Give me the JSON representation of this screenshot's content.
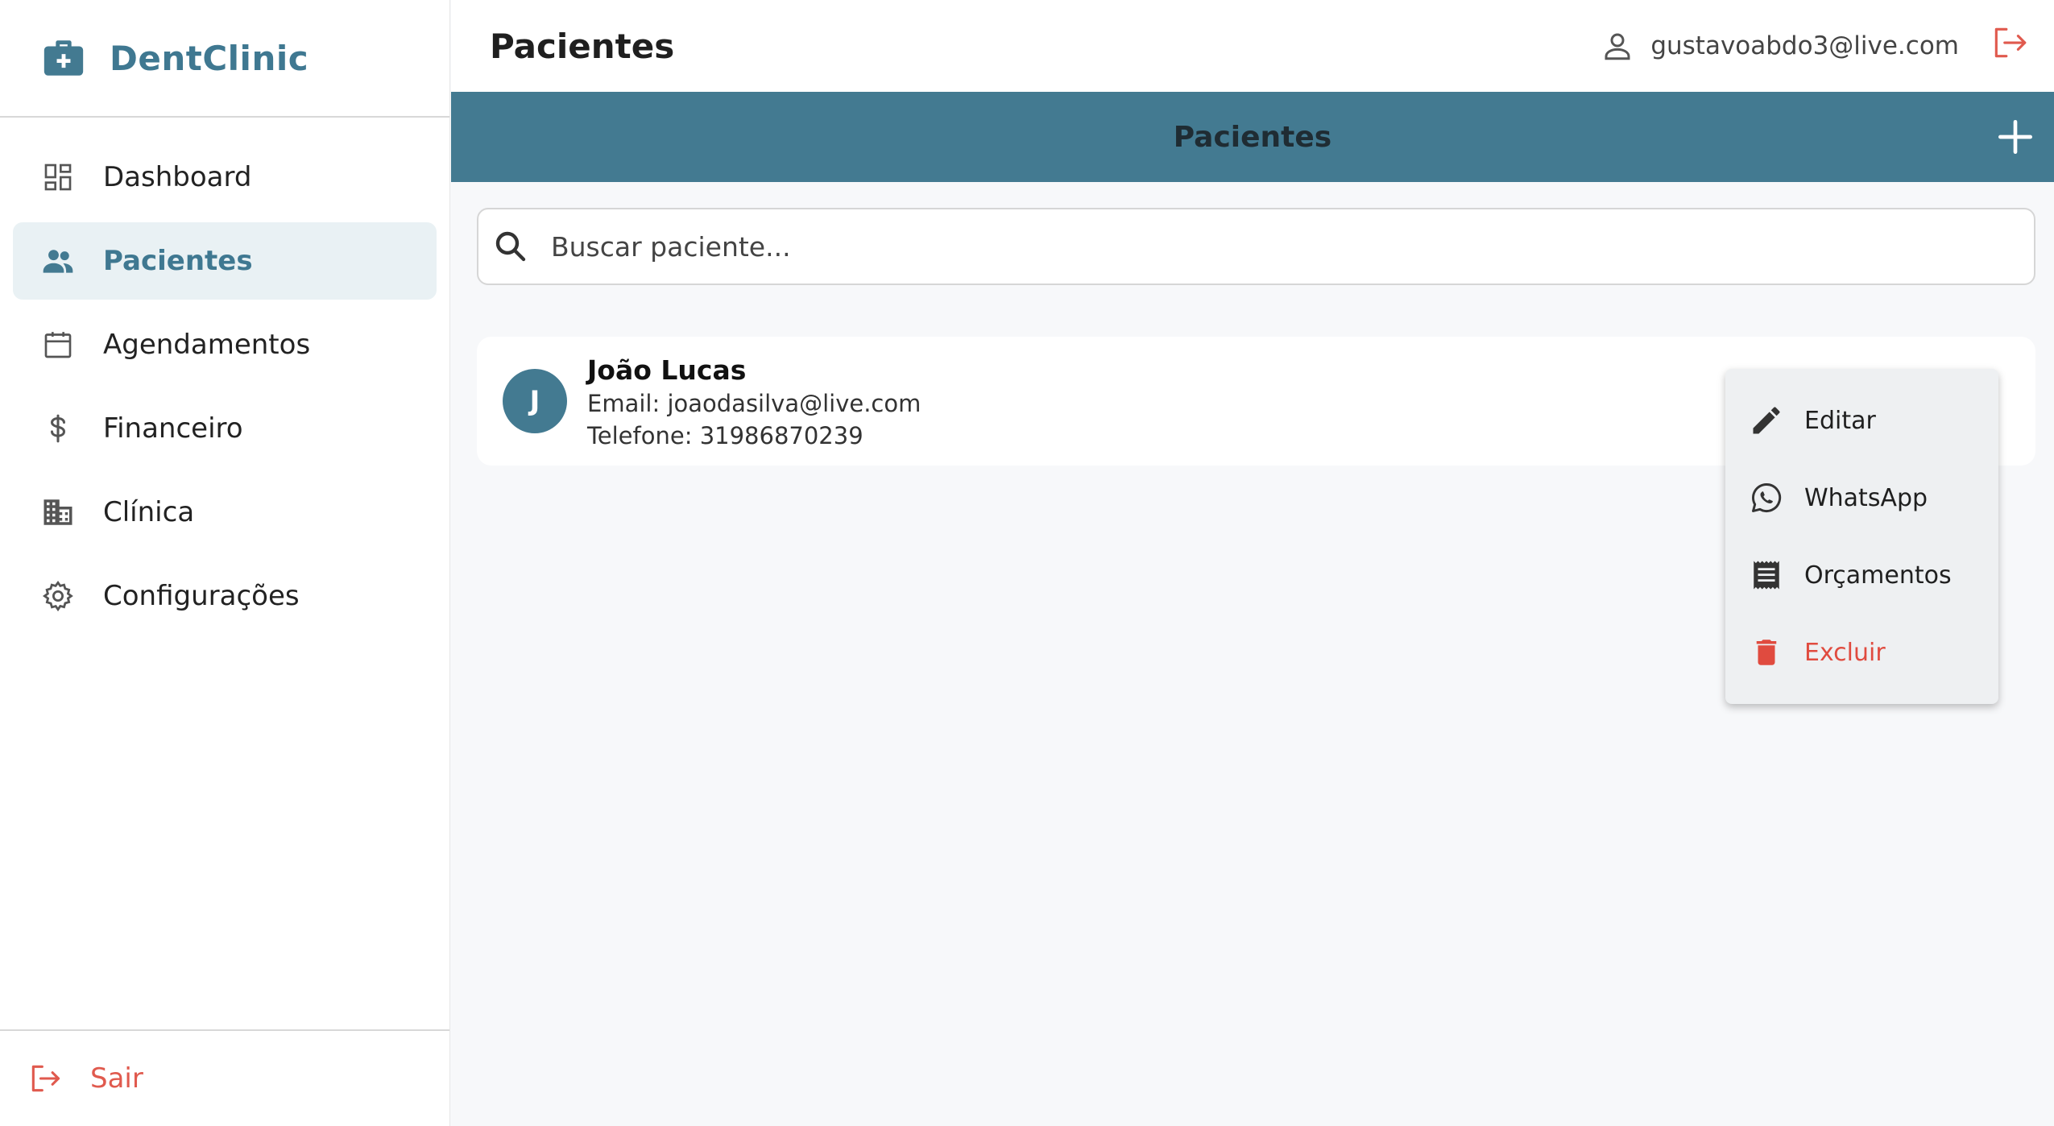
{
  "brand": {
    "name": "DentClinic"
  },
  "sidebar": {
    "items": [
      {
        "label": "Dashboard",
        "icon": "dashboard-icon"
      },
      {
        "label": "Pacientes",
        "icon": "people-icon",
        "active": true
      },
      {
        "label": "Agendamentos",
        "icon": "calendar-icon"
      },
      {
        "label": "Financeiro",
        "icon": "dollar-icon"
      },
      {
        "label": "Clínica",
        "icon": "building-icon"
      },
      {
        "label": "Configurações",
        "icon": "gear-icon"
      }
    ],
    "logout_label": "Sair"
  },
  "header": {
    "title": "Pacientes",
    "user_email": "gustavoabdo3@live.com"
  },
  "section": {
    "title": "Pacientes"
  },
  "search": {
    "placeholder": "Buscar paciente...",
    "value": ""
  },
  "patients": [
    {
      "initial": "J",
      "name": "João Lucas",
      "email": "Email: joaodasilva@live.com",
      "phone": "Telefone: 31986870239"
    }
  ],
  "context_menu": {
    "items": [
      {
        "label": "Editar",
        "icon": "pencil-icon"
      },
      {
        "label": "WhatsApp",
        "icon": "whatsapp-icon"
      },
      {
        "label": "Orçamentos",
        "icon": "receipt-icon"
      },
      {
        "label": "Excluir",
        "icon": "trash-icon"
      }
    ]
  },
  "colors": {
    "primary": "#437a91",
    "brand_text": "#3f7891",
    "danger": "#e04b3f",
    "active_bg": "#e9f1f4"
  }
}
